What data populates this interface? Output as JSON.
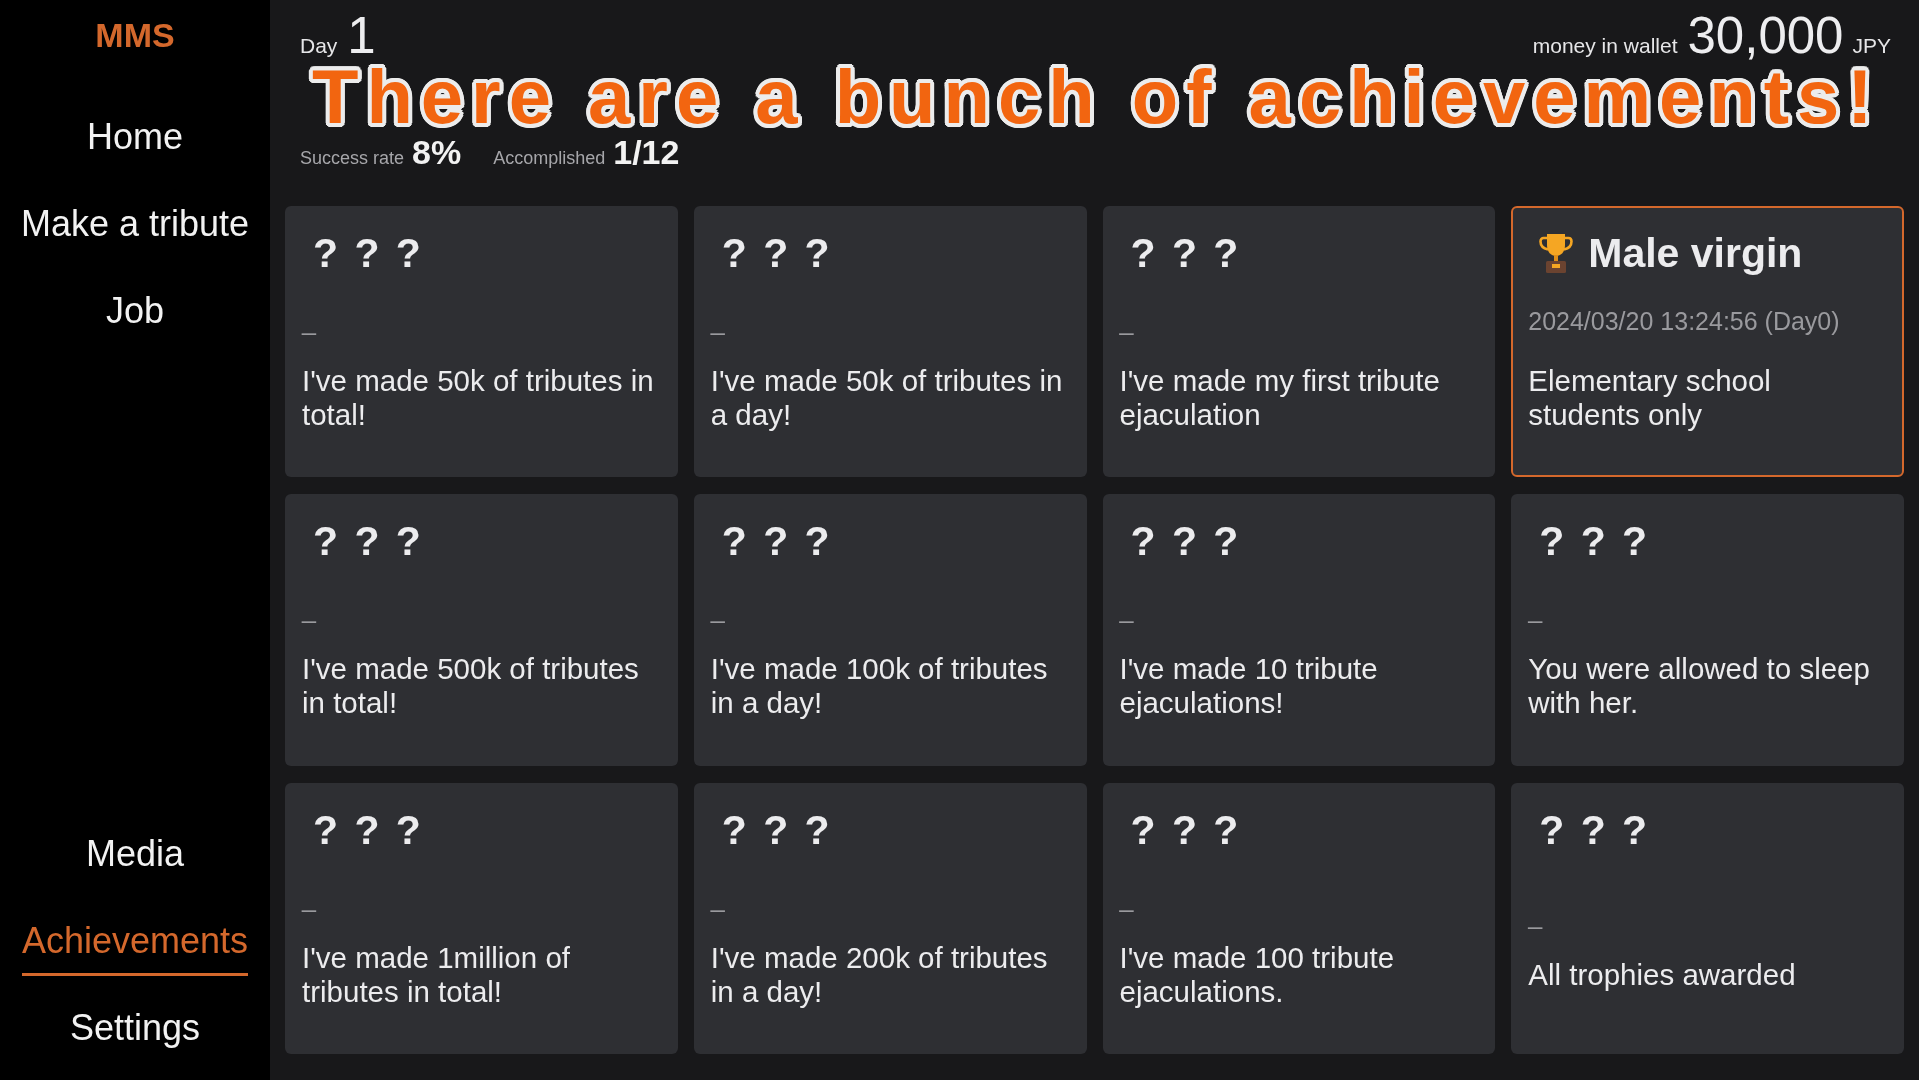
{
  "sidebar": {
    "logo": "MMS",
    "top_items": [
      {
        "label": "Home",
        "selected": false
      },
      {
        "label": "Make a tribute",
        "selected": false
      },
      {
        "label": "Job",
        "selected": false
      }
    ],
    "bottom_items": [
      {
        "label": "Media",
        "selected": false
      },
      {
        "label": "Achievements",
        "selected": true
      },
      {
        "label": "Settings",
        "selected": false
      }
    ]
  },
  "header": {
    "day_label": "Day",
    "day_value": "1",
    "wallet_label": "money in wallet",
    "wallet_amount": "30,000",
    "wallet_unit": "JPY"
  },
  "caption": "There are a bunch of achievements!",
  "stats": [
    {
      "label": "Success rate",
      "value": "8%"
    },
    {
      "label": "Accomplished",
      "value": "1/12"
    }
  ],
  "achievements": [
    {
      "title": "? ? ?",
      "date": "_",
      "description": "I've made 50k of tributes in total!",
      "achieved": false
    },
    {
      "title": "? ? ?",
      "date": "_",
      "description": "I've made 50k of tributes in a day!",
      "achieved": false
    },
    {
      "title": "? ? ?",
      "date": "_",
      "description": "I've made my first tribute ejaculation",
      "achieved": false
    },
    {
      "title": "Male virgin",
      "date": "2024/03/20 13:24:56 (Day0)",
      "description": "Elementary school students only",
      "achieved": true
    },
    {
      "title": "? ? ?",
      "date": "_",
      "description": "I've made 500k of tributes in total!",
      "achieved": false
    },
    {
      "title": "? ? ?",
      "date": "_",
      "description": "I've made 100k of tributes in a day!",
      "achieved": false
    },
    {
      "title": "? ? ?",
      "date": "_",
      "description": "I've made 10 tribute ejaculations!",
      "achieved": false
    },
    {
      "title": "? ? ?",
      "date": "_",
      "description": "You were allowed to sleep with her.",
      "achieved": false
    },
    {
      "title": "? ? ?",
      "date": "_",
      "description": "I've made 1million of tributes in total!",
      "achieved": false
    },
    {
      "title": "? ? ?",
      "date": "_",
      "description": "I've made 200k of tributes in a day!",
      "achieved": false
    },
    {
      "title": "? ? ?",
      "date": "_",
      "description": "I've made 100 tribute ejaculations.",
      "achieved": false
    },
    {
      "title": "? ? ?",
      "date": "_",
      "description": "All trophies awarded",
      "achieved": false
    }
  ]
}
